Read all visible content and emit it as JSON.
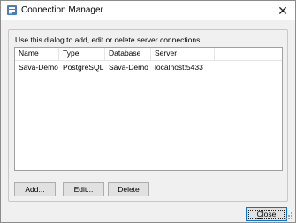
{
  "window": {
    "title": "Connection Manager",
    "close_glyph": "✕"
  },
  "dialog": {
    "description": "Use this dialog to add, edit or delete server connections."
  },
  "list": {
    "columns": [
      "Name",
      "Type",
      "Database",
      "Server"
    ],
    "rows": [
      [
        "Sava-Demo",
        "PostgreSQL",
        "Sava-Demo",
        "localhost:5433"
      ]
    ]
  },
  "buttons": {
    "add": "Add...",
    "edit": "Edit...",
    "delete": "Delete",
    "close_first": "C",
    "close_rest": "lose"
  },
  "icons": {
    "app": "database-server-icon",
    "close": "close-icon",
    "grip": "resize-grip-icon"
  },
  "colors": {
    "focus_border": "#0078d7",
    "button_face": "#e1e1e1",
    "dialog_bg": "#f0f0f0"
  }
}
